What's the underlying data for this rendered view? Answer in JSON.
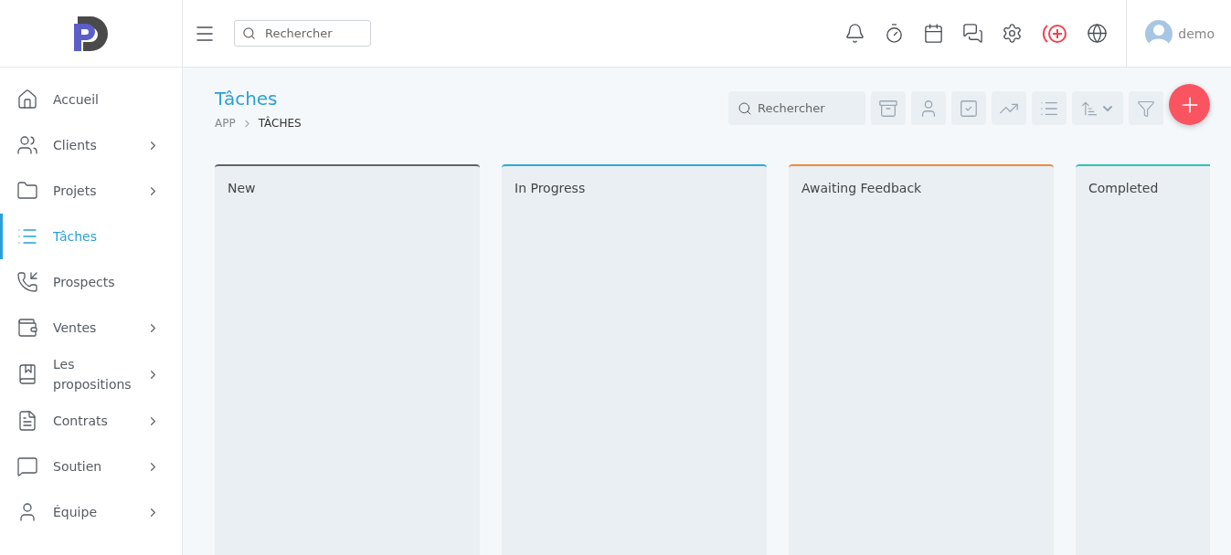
{
  "header": {
    "search": {
      "placeholder": "Rechercher"
    },
    "user": {
      "name": "demo"
    }
  },
  "sidebar": {
    "items": [
      {
        "label": "Accueil",
        "selected": false,
        "expandable": false
      },
      {
        "label": "Clients",
        "selected": false,
        "expandable": true
      },
      {
        "label": "Projets",
        "selected": false,
        "expandable": true
      },
      {
        "label": "Tâches",
        "selected": true,
        "expandable": false
      },
      {
        "label": "Prospects",
        "selected": false,
        "expandable": false
      },
      {
        "label": "Ventes",
        "selected": false,
        "expandable": true
      },
      {
        "label": "Les propositions",
        "selected": false,
        "expandable": true
      },
      {
        "label": "Contrats",
        "selected": false,
        "expandable": true
      },
      {
        "label": "Soutien",
        "selected": false,
        "expandable": true
      },
      {
        "label": "Équipe",
        "selected": false,
        "expandable": true
      }
    ]
  },
  "page": {
    "title": "Tâches",
    "breadcrumb": [
      "APP",
      "TÂCHES"
    ],
    "search": {
      "placeholder": "Rechercher"
    }
  },
  "board": {
    "columns": [
      {
        "title": "New",
        "color": "#5f6368"
      },
      {
        "title": "In Progress",
        "color": "#2ea7d6"
      },
      {
        "title": "Awaiting Feedback",
        "color": "#f08a3c"
      },
      {
        "title": "Completed",
        "color": "#2ec4b6"
      }
    ]
  }
}
